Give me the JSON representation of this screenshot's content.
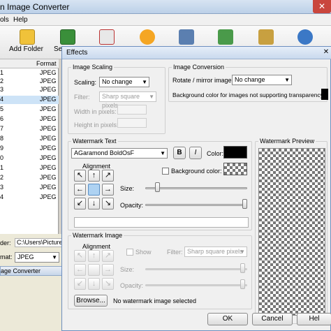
{
  "window": {
    "title": "n Image Converter",
    "close": "✕"
  },
  "menu": {
    "tools": "ols",
    "help": "Help"
  },
  "toolbar": {
    "add_folder": "Add Folder",
    "next": "Se"
  },
  "filelist": {
    "col_format": "Format",
    "row_numbers": [
      "1",
      "2",
      "3",
      "4",
      "5",
      "6",
      "7",
      "8",
      "9",
      "0",
      "1",
      "2",
      "3",
      "4"
    ],
    "formats": [
      "JPEG",
      "JPEG",
      "JPEG",
      "JPEG",
      "JPEG",
      "JPEG",
      "JPEG",
      "JPEG",
      "JPEG",
      "JPEG",
      "JPEG",
      "JPEG",
      "JPEG",
      "JPEG"
    ]
  },
  "bottom": {
    "folder_label": "der:",
    "folder_value": "C:\\Users\\Picture",
    "format_label": "mat:",
    "format_value": "JPEG",
    "status": "age Converter"
  },
  "dialog": {
    "title": "Effects",
    "image_scaling": {
      "title": "Image Scaling",
      "scaling_label": "Scaling:",
      "scaling_value": "No change",
      "filter_label": "Filter:",
      "filter_value": "Sharp square pixels",
      "width_label": "Width in pixels:",
      "height_label": "Height in pixels:"
    },
    "image_conversion": {
      "title": "Image Conversion",
      "rotate_label": "Rotate / mirror image:",
      "rotate_value": "No change",
      "bg_label": "Background color for images not supporting transparency:"
    },
    "watermark_text": {
      "title": "Watermark Text",
      "font_value": "AGaramond BoldOsF",
      "bold": "B",
      "italic": "I",
      "color_label": "Color:",
      "alignment_label": "Alignment",
      "bg_color_label": "Background color:",
      "size_label": "Size:",
      "opacity_label": "Opacity:",
      "size_level": 0.1,
      "opacity_level": 1.0
    },
    "watermark_preview": {
      "title": "Watermark Preview"
    },
    "watermark_image": {
      "title": "Watermark Image",
      "alignment_label": "Alignment",
      "show_label": "Show",
      "filter_label": "Filter:",
      "filter_value": "Sharp square pixels",
      "size_label": "Size:",
      "opacity_label": "Opacity:",
      "browse": "Browse...",
      "status": "No watermark image selected"
    },
    "buttons": {
      "ok": "OK",
      "cancel": "Cancel",
      "help": "Hel"
    }
  },
  "colors": {
    "watermark_color": "#000000",
    "accent": "#aed2f2"
  }
}
